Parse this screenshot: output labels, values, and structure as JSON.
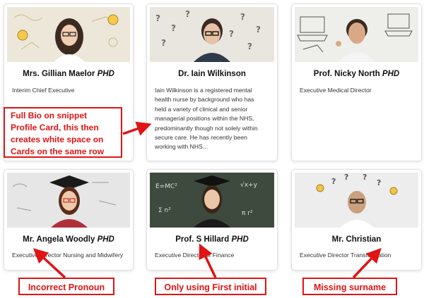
{
  "cards": [
    {
      "name": "Mrs. Gillian Maelor",
      "suffix": "PHD",
      "role": "Interim Chief Executive"
    },
    {
      "name": "Dr. Iain Wilkinson",
      "suffix": "",
      "bio_lines": [
        "Iain Wilkinson  is a registered mental",
        "health nurse by background who has",
        "held a variety of clinical and senior",
        "managerial positions within the NHS,",
        "predominantly though not solely within",
        "secure care. He has recently been",
        "working with NHS..."
      ]
    },
    {
      "name": "Prof. Nicky North",
      "suffix": "PHD",
      "role": "Executive Medical Director"
    },
    {
      "name": "Mr. Angela Woodly",
      "suffix": "PHD",
      "role": "Executive Director Nursing and Midwifery"
    },
    {
      "name": "Prof. S Hillard",
      "suffix": "PHD",
      "role": "Executive Director of Finance"
    },
    {
      "name": "Mr. Christian",
      "suffix": "",
      "role": "Executive Director Transformation"
    }
  ],
  "callouts": {
    "full_bio": [
      "Full Bio on snippet",
      "Profile Card, this then",
      "creates white space on",
      "Cards on the same row"
    ],
    "pronoun": "Incorrect Pronoun",
    "initial": "Only using First initial",
    "surname": "Missing surname"
  },
  "colors": {
    "annotation": "#e01414",
    "card_border": "#e2e2e2"
  }
}
